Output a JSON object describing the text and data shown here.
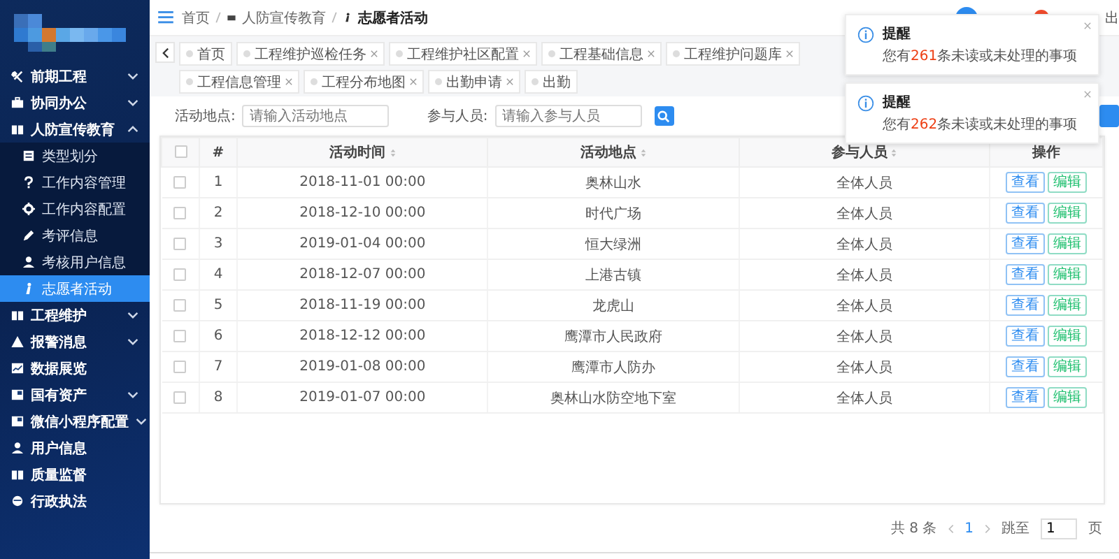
{
  "sidebar": {
    "items": [
      {
        "label": "前期工程",
        "expanded": false
      },
      {
        "label": "协同办公",
        "expanded": false
      },
      {
        "label": "人防宣传教育",
        "expanded": true,
        "children": [
          {
            "label": "类型划分",
            "selected": false
          },
          {
            "label": "工作内容管理",
            "selected": false
          },
          {
            "label": "工作内容配置",
            "selected": false
          },
          {
            "label": "考评信息",
            "selected": false
          },
          {
            "label": "考核用户信息",
            "selected": false
          },
          {
            "label": "志愿者活动",
            "selected": true
          }
        ]
      },
      {
        "label": "工程维护",
        "expanded": false
      },
      {
        "label": "报警消息",
        "expanded": false
      },
      {
        "label": "数据展览"
      },
      {
        "label": "国有资产",
        "expanded": false
      },
      {
        "label": "微信小程序配置",
        "expanded": false
      },
      {
        "label": "用户信息"
      },
      {
        "label": "质量监督"
      },
      {
        "label": "行政执法"
      }
    ]
  },
  "breadcrumb": [
    "首页",
    "人防宣传教育",
    "志愿者活动"
  ],
  "header": {
    "exit_text": "出"
  },
  "tabs": [
    {
      "label": "首页",
      "closable": false
    },
    {
      "label": "工程维护巡检任务",
      "closable": true
    },
    {
      "label": "工程维护社区配置",
      "closable": true
    },
    {
      "label": "工程基础信息",
      "closable": true
    },
    {
      "label": "工程维护问题库",
      "closable": true
    },
    {
      "label": "工程信息管理",
      "closable": true
    },
    {
      "label": "工程分布地图",
      "closable": true
    },
    {
      "label": "出勤申请",
      "closable": true
    },
    {
      "label": "出勤",
      "closable": false
    }
  ],
  "filters": [
    {
      "label": "活动地点:",
      "placeholder": "请输入活动地点"
    },
    {
      "label": "参与人员:",
      "placeholder": "请输入参与人员"
    }
  ],
  "table": {
    "all_checked": false,
    "columns": [
      {
        "label": "#",
        "sortable": false
      },
      {
        "label": "活动时间",
        "sortable": true
      },
      {
        "label": "活动地点",
        "sortable": true
      },
      {
        "label": "参与人员",
        "sortable": true
      },
      {
        "label": "操作",
        "sortable": false
      }
    ],
    "rows": [
      {
        "checked": false,
        "cells": [
          "1",
          "2018-11-01 00:00",
          "奥林山水",
          "全体人员"
        ],
        "actions": [
          {
            "kind": "view",
            "label": "查看"
          },
          {
            "kind": "edit",
            "label": "编辑"
          }
        ]
      },
      {
        "checked": false,
        "cells": [
          "2",
          "2018-12-10 00:00",
          "时代广场",
          "全体人员"
        ],
        "actions": [
          {
            "kind": "view",
            "label": "查看"
          },
          {
            "kind": "edit",
            "label": "编辑"
          }
        ]
      },
      {
        "checked": false,
        "cells": [
          "3",
          "2019-01-04 00:00",
          "恒大绿洲",
          "全体人员"
        ],
        "actions": [
          {
            "kind": "view",
            "label": "查看"
          },
          {
            "kind": "edit",
            "label": "编辑"
          }
        ]
      },
      {
        "checked": false,
        "cells": [
          "4",
          "2018-12-07 00:00",
          "上港古镇",
          "全体人员"
        ],
        "actions": [
          {
            "kind": "view",
            "label": "查看"
          },
          {
            "kind": "edit",
            "label": "编辑"
          }
        ]
      },
      {
        "checked": false,
        "cells": [
          "5",
          "2018-11-19 00:00",
          "龙虎山",
          "全体人员"
        ],
        "actions": [
          {
            "kind": "view",
            "label": "查看"
          },
          {
            "kind": "edit",
            "label": "编辑"
          }
        ]
      },
      {
        "checked": false,
        "cells": [
          "6",
          "2018-12-12 00:00",
          "鹰潭市人民政府",
          "全体人员"
        ],
        "actions": [
          {
            "kind": "view",
            "label": "查看"
          },
          {
            "kind": "edit",
            "label": "编辑"
          }
        ]
      },
      {
        "checked": false,
        "cells": [
          "7",
          "2019-01-08 00:00",
          "鹰潭市人防办",
          "全体人员"
        ],
        "actions": [
          {
            "kind": "view",
            "label": "查看"
          },
          {
            "kind": "edit",
            "label": "编辑"
          }
        ]
      },
      {
        "checked": false,
        "cells": [
          "8",
          "2019-01-07 00:00",
          "奥林山水防空地下室",
          "全体人员"
        ],
        "actions": [
          {
            "kind": "view",
            "label": "查看"
          },
          {
            "kind": "edit",
            "label": "编辑"
          }
        ]
      }
    ]
  },
  "pagination": {
    "total": "共 8 条",
    "pages": [
      {
        "label": "1",
        "selected": true
      }
    ],
    "jump_label": "跳至",
    "jump_value": "1",
    "page_unit": "页"
  },
  "notifications": [
    {
      "title": "提醒",
      "message_before": "您有",
      "count": "261",
      "message_after": "条未读或未处理的事项"
    },
    {
      "title": "提醒",
      "message_before": "您有",
      "count": "262",
      "message_after": "条未读或未处理的事项"
    }
  ]
}
